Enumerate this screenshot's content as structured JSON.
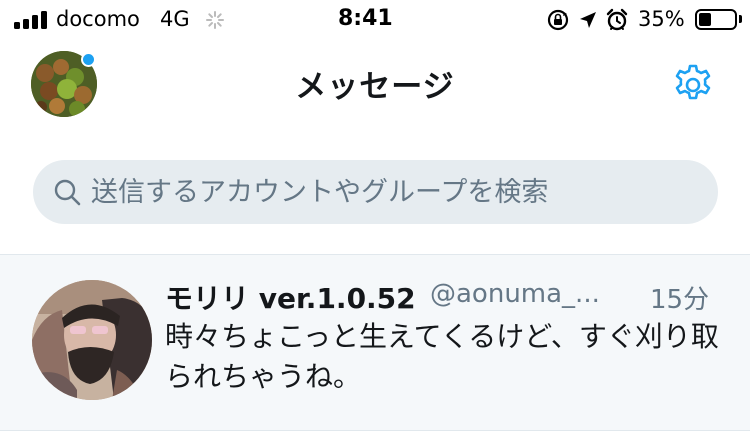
{
  "status_bar": {
    "carrier": "docomo",
    "network": "4G",
    "time": "8:41",
    "battery_percent": "35%",
    "battery_level": 0.35,
    "icons": [
      "signal-icon",
      "loading-spinner-icon",
      "rotation-lock-icon",
      "location-arrow-icon",
      "alarm-clock-icon",
      "battery-icon"
    ]
  },
  "header": {
    "title": "メッセージ",
    "profile_avatar": "profile-photo",
    "settings_icon": "gear-icon"
  },
  "search": {
    "placeholder": "送信するアカウントやグループを検索",
    "value": ""
  },
  "conversations": [
    {
      "name": "モリリ ver.1.0.52",
      "handle": "@aonuma_...",
      "time": "15分",
      "preview": "時々ちょこっと生えてくるけど、すぐ刈り取られちゃうね。"
    }
  ],
  "colors": {
    "accent": "#1da1f2",
    "search_bg": "#e6ecf0",
    "row_bg": "#f5f8fa",
    "secondary_text": "#657786"
  }
}
